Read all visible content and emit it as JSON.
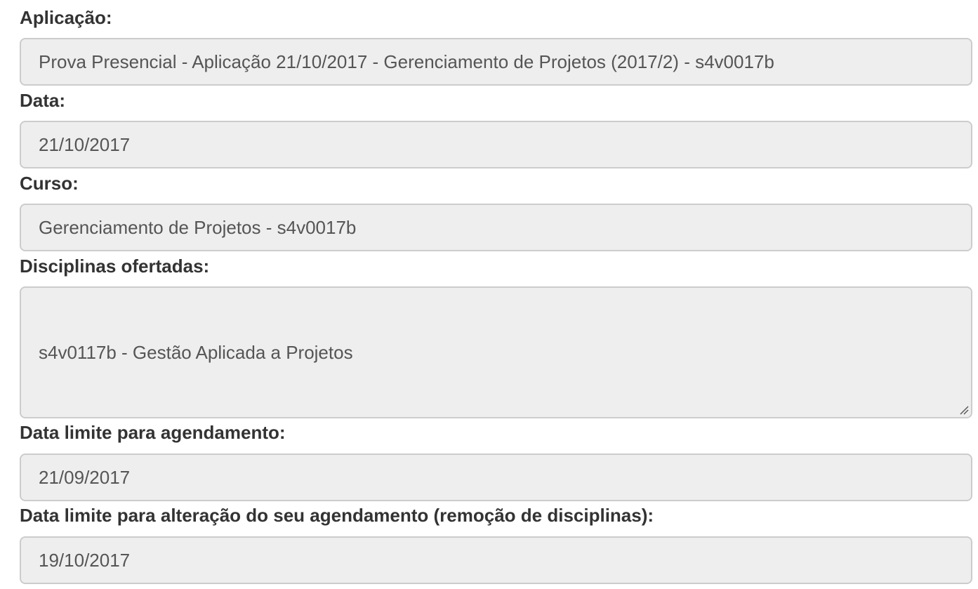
{
  "fields": [
    {
      "label": "Aplicação:",
      "value": "Prova Presencial - Aplicação 21/10/2017 - Gerenciamento de Projetos (2017/2) - s4v0017b"
    },
    {
      "label": "Data:",
      "value": "21/10/2017"
    },
    {
      "label": "Curso:",
      "value": "Gerenciamento de Projetos - s4v0017b"
    },
    {
      "label": "Disciplinas ofertadas:",
      "value": "s4v0117b - Gestão Aplicada a Projetos"
    },
    {
      "label": "Data limite para agendamento:",
      "value": "21/09/2017"
    },
    {
      "label": "Data limite para alteração do seu agendamento (remoção de disciplinas):",
      "value": "19/10/2017"
    }
  ],
  "icons": {
    "resize": "resize-handle-icon"
  },
  "colors": {
    "field_bg": "#eeeeee",
    "field_border": "#cccccc",
    "label_text": "#333333",
    "field_text": "#555555"
  }
}
